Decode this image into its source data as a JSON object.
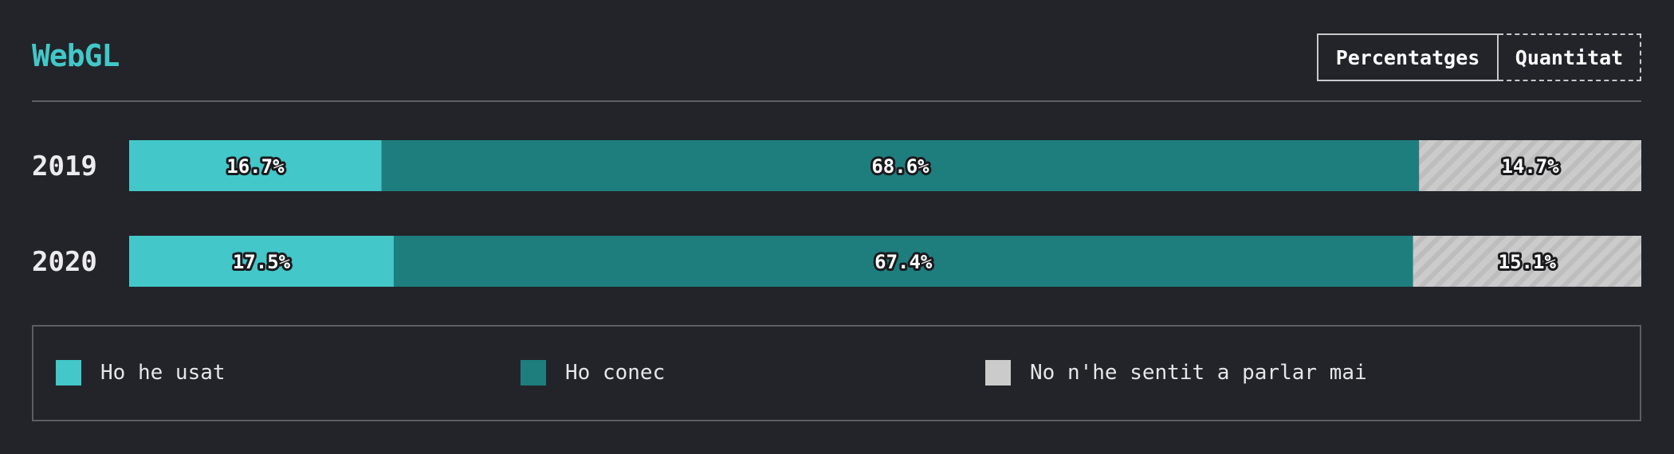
{
  "header": {
    "title": "WebGL",
    "toggle": {
      "percent_label": "Percentatges",
      "count_label": "Quantitat",
      "selected": "percent"
    }
  },
  "colors": {
    "background": "#232429",
    "used": "#43c7c9",
    "known": "#1e7e7e",
    "never": "#cbcbcb",
    "title": "#42c8c9"
  },
  "chart_data": {
    "type": "bar",
    "orientation": "horizontal",
    "stacked": true,
    "normalized": true,
    "categories": [
      "2019",
      "2020"
    ],
    "series": [
      {
        "name": "Ho he usat",
        "values": [
          16.7,
          17.5
        ],
        "labels": [
          "16.7%",
          "17.5%"
        ],
        "color": "#43c7c9",
        "pattern": "none"
      },
      {
        "name": "Ho conec",
        "values": [
          68.6,
          67.4
        ],
        "labels": [
          "68.6%",
          "67.4%"
        ],
        "color": "#1e7e7e",
        "pattern": "none"
      },
      {
        "name": "No n'he sentit a parlar mai",
        "values": [
          14.7,
          15.1
        ],
        "labels": [
          "14.7%",
          "15.1%"
        ],
        "color": "#cbcbcb",
        "pattern": "diagonal-stripes"
      }
    ],
    "xlim": [
      0,
      100
    ],
    "grid": false,
    "legend_position": "bottom"
  }
}
